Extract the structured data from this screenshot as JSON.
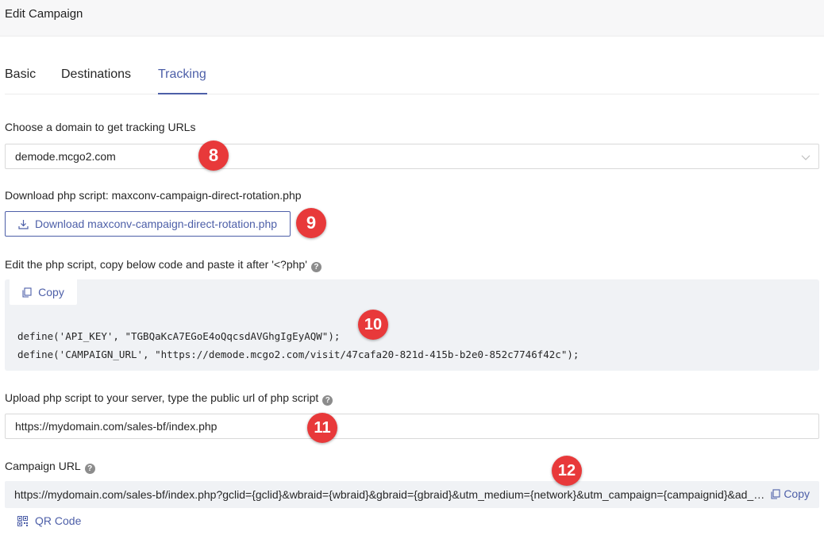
{
  "header": {
    "title": "Edit Campaign"
  },
  "tabs": [
    {
      "label": "Basic"
    },
    {
      "label": "Destinations"
    },
    {
      "label": "Tracking"
    }
  ],
  "domain": {
    "label": "Choose a domain to get tracking URLs",
    "selected": "demode.mcgo2.com"
  },
  "download": {
    "label": "Download php script: maxconv-campaign-direct-rotation.php",
    "button_label": "Download maxconv-campaign-direct-rotation.php"
  },
  "edit_script": {
    "label": "Edit the php script, copy below code and paste it after '<?php'",
    "copy_label": "Copy",
    "code_lines": [
      "define('API_KEY', \"TGBQaKcA7EGoE4oQqcsdAVGhgIgEyAQW\");",
      "define('CAMPAIGN_URL', \"https://demode.mcgo2.com/visit/47cafa20-821d-415b-b2e0-852c7746f42c\");"
    ]
  },
  "upload": {
    "label": "Upload php script to your server, type the public url of php script",
    "value": "https://mydomain.com/sales-bf/index.php"
  },
  "campaign_url": {
    "label": "Campaign URL",
    "value": "https://mydomain.com/sales-bf/index.php?gclid={gclid}&wbraid={wbraid}&gbraid={gbraid}&utm_medium={network}&utm_campaign={campaignid}&ad_group={adgroupid}",
    "copy_label": "Copy",
    "qr_label": "QR Code"
  },
  "badges": [
    "8",
    "9",
    "10",
    "11",
    "12"
  ],
  "colors": {
    "accent": "#4d5fa8",
    "badge": "#e8393a",
    "code_bg": "#f0f2f5"
  }
}
